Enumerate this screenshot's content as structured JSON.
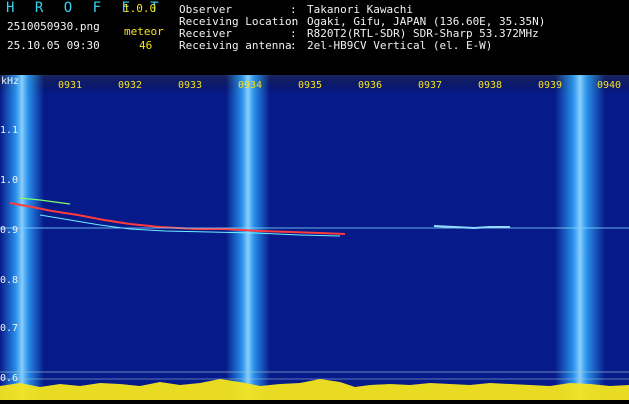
{
  "header": {
    "app_title": "H R O F F T",
    "app_version": "1.0.0",
    "file_name": "2510050930.png",
    "meteor_label": "meteor",
    "date_time": "25.10.05 09:30",
    "meteor_count": "46"
  },
  "info": [
    {
      "label": "Observer",
      "value": "Takanori Kawachi"
    },
    {
      "label": "Receiving Location",
      "value": "Ogaki, Gifu, JAPAN (136.60E, 35.35N)"
    },
    {
      "label": "Receiver",
      "value": "R820T2(RTL-SDR) SDR-Sharp 53.372MHz"
    },
    {
      "label": "Receiving antenna",
      "value": "2el-HB9CV Vertical (el. E-W)"
    }
  ],
  "spectrogram": {
    "y_unit": "kHz",
    "y_ticks": [
      "1.1",
      "1.0",
      "0.9",
      "0.8",
      "0.7",
      "0.6"
    ],
    "x_ticks": [
      "0931",
      "0932",
      "0933",
      "0934",
      "0935",
      "0936",
      "0937",
      "0938",
      "0939",
      "0940"
    ],
    "background_color": "#071a8a",
    "band_color": "#2ea8ff",
    "trace_color": "#ff3b3b",
    "baseline_color": "#f6e51c"
  }
}
